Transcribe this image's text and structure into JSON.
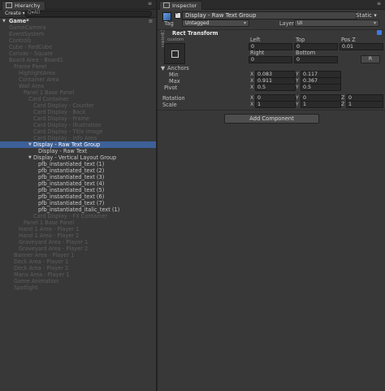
{
  "hierarchy": {
    "tab_label": "Hierarchy",
    "create_label": "Create ▾",
    "search_glyph": "Q▾All",
    "scene_label": "Game*",
    "rows": [
      {
        "label": "GameCamera",
        "depth": 1,
        "faded": true
      },
      {
        "label": "EventSystem",
        "depth": 1,
        "faded": true
      },
      {
        "label": "Controls",
        "depth": 1,
        "faded": true
      },
      {
        "label": "Cube - RedCube",
        "depth": 1,
        "faded": true
      },
      {
        "label": "Canvas - Square",
        "depth": 1,
        "faded": true
      },
      {
        "label": "Board Area - Board1",
        "depth": 1,
        "faded": true
      },
      {
        "label": "Frame Panel",
        "depth": 2,
        "faded": true
      },
      {
        "label": "HighlightArea",
        "depth": 3,
        "faded": true
      },
      {
        "label": "Container Area",
        "depth": 3,
        "faded": true
      },
      {
        "label": "Wall Area",
        "depth": 3,
        "faded": true
      },
      {
        "label": "Panel 1 Base Panel",
        "depth": 4,
        "faded": true
      },
      {
        "label": "Card Container",
        "depth": 5,
        "faded": true
      },
      {
        "label": "Card Display - Counter",
        "depth": 6,
        "faded": true
      },
      {
        "label": "Card Display - Back",
        "depth": 6,
        "faded": true
      },
      {
        "label": "Card Display - Frame",
        "depth": 6,
        "faded": true
      },
      {
        "label": "Card Display - Illustration",
        "depth": 6,
        "faded": true
      },
      {
        "label": "Card Display - Title Image",
        "depth": 6,
        "faded": true
      },
      {
        "label": "Card Display - Info Area",
        "depth": 6,
        "faded": true
      },
      {
        "label": "Display - Raw Text Group",
        "depth": 6,
        "faded": false,
        "selected": true,
        "arrow": "▼"
      },
      {
        "label": "Display - Raw Text",
        "depth": 7,
        "faded": false
      },
      {
        "label": "Display - Vertical Layout Group",
        "depth": 6,
        "faded": false,
        "arrow": "▼"
      },
      {
        "label": "pfb_instantiated_text (1)",
        "depth": 7,
        "faded": false
      },
      {
        "label": "pfb_instantiated_text (2)",
        "depth": 7,
        "faded": false
      },
      {
        "label": "pfb_instantiated_text (3)",
        "depth": 7,
        "faded": false
      },
      {
        "label": "pfb_instantiated_text (4)",
        "depth": 7,
        "faded": false
      },
      {
        "label": "pfb_instantiated_text (5)",
        "depth": 7,
        "faded": false
      },
      {
        "label": "pfb_instantiated_text (6)",
        "depth": 7,
        "faded": false
      },
      {
        "label": "pfb_instantiated_text (7)",
        "depth": 7,
        "faded": false
      },
      {
        "label": "pfb_instantiated_italic_text (1)",
        "depth": 7,
        "faded": false
      },
      {
        "label": "Card Display - FX Container",
        "depth": 6,
        "faded": true
      },
      {
        "label": "Panel 1 Base Panel",
        "depth": 4,
        "faded": true
      },
      {
        "label": "Hand 1 Area - Player 1",
        "depth": 3,
        "faded": true
      },
      {
        "label": "Hand 1 Area - Player 2",
        "depth": 3,
        "faded": true
      },
      {
        "label": "Graveyard Area - Player 1",
        "depth": 3,
        "faded": true
      },
      {
        "label": "Graveyard Area - Player 2",
        "depth": 3,
        "faded": true
      },
      {
        "label": "Banner Area - Player 1",
        "depth": 2,
        "faded": true
      },
      {
        "label": "Deck Area - Player 1",
        "depth": 2,
        "faded": true
      },
      {
        "label": "Deck Area - Player 2",
        "depth": 2,
        "faded": true
      },
      {
        "label": "Mana Area - Player 1",
        "depth": 2,
        "faded": true
      },
      {
        "label": "Game Animation",
        "depth": 2,
        "faded": true
      },
      {
        "label": "Spotlight",
        "depth": 2,
        "faded": true
      }
    ]
  },
  "inspector": {
    "tab_label": "Inspector",
    "object_name": "Display - Raw Text Group",
    "static_label": "Static ▾",
    "tag_label": "Tag",
    "tag_value": "Untagged",
    "layer_label": "Layer",
    "layer_value": "UI",
    "component_title": "Rect Transform",
    "preset_label": "custom",
    "preset_side_label": "custom",
    "col_left": "Left",
    "col_top": "Top",
    "col_posz": "Pos Z",
    "val_left": "0",
    "val_top": "0",
    "val_posz": "0.01",
    "col_right": "Right",
    "col_bottom": "Bottom",
    "val_right": "0",
    "val_bottom": "0",
    "r_button": "R",
    "anchors_label": "Anchors",
    "min_label": "Min",
    "min_x": "0.083",
    "min_y": "0.117",
    "max_label": "Max",
    "max_x": "0.911",
    "max_y": "0.367",
    "pivot_label": "Pivot",
    "pivot_x": "0.5",
    "pivot_y": "0.5",
    "rotation_label": "Rotation",
    "rot_x": "0",
    "rot_y": "0",
    "rot_z": "0",
    "scale_label": "Scale",
    "scale_x": "1",
    "scale_y": "1",
    "scale_z": "1",
    "add_component": "Add Component",
    "axis_x": "X",
    "axis_y": "Y",
    "axis_z": "Z"
  },
  "colors": {
    "selection": "#3d6098",
    "panel_bg": "#383838",
    "field_bg": "#2a2a2a"
  }
}
